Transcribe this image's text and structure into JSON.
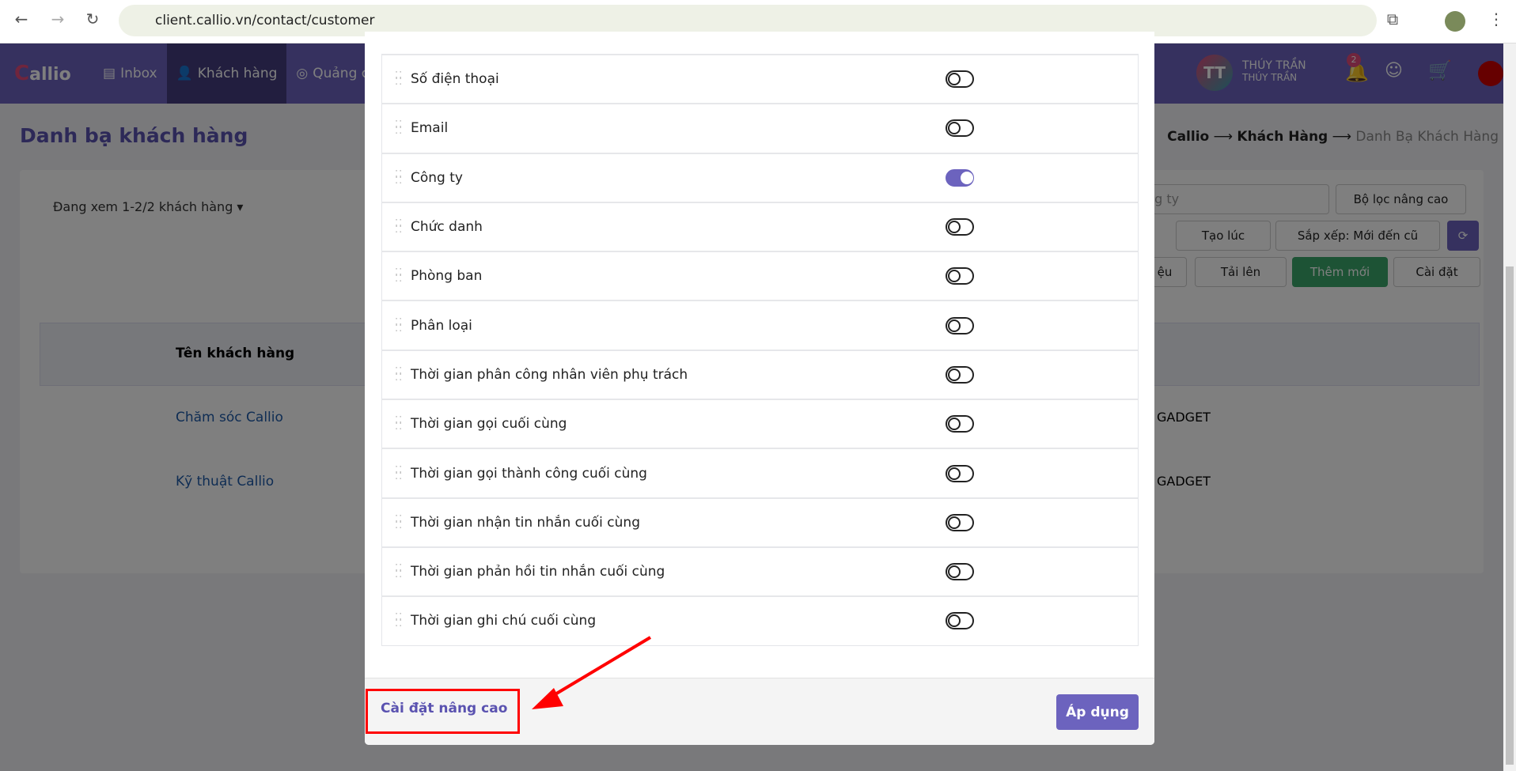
{
  "browser": {
    "url": "client.callio.vn/contact/customer"
  },
  "nav": {
    "logo": "Callio",
    "items": [
      {
        "label": "Inbox"
      },
      {
        "label": "Khách hàng",
        "active": true
      },
      {
        "label": "Quảng cáo"
      }
    ],
    "user": {
      "initials": "TT",
      "name": "THÚY TRẦN",
      "sub": "THÚY TRẦN"
    },
    "notifications": "2"
  },
  "page": {
    "title": "Danh bạ khách hàng",
    "breadcrumb": [
      "Callio",
      "Khách Hàng",
      "Danh Bạ Khách Hàng"
    ],
    "viewing": "Đang xem 1-2/2 khách hàng",
    "search_partial": "ng ty",
    "buttons": {
      "advanced_filter": "Bộ lọc nâng cao",
      "created": "Tạo lúc",
      "sort": "Sắp xếp: Mới đến cũ",
      "data_partial": "ệu",
      "upload": "Tải lên",
      "add_new": "Thêm mới",
      "settings": "Cài đặt"
    },
    "table": {
      "header": "Tên khách hàng",
      "rows": [
        {
          "name": "Chăm sóc Callio",
          "company": "GADGET"
        },
        {
          "name": "Kỹ thuật Callio",
          "company": "GADGET"
        }
      ]
    }
  },
  "modal": {
    "fields": [
      {
        "label": "Số điện thoại",
        "enabled": false
      },
      {
        "label": "Email",
        "enabled": false
      },
      {
        "label": "Công ty",
        "enabled": true
      },
      {
        "label": "Chức danh",
        "enabled": false
      },
      {
        "label": "Phòng ban",
        "enabled": false
      },
      {
        "label": "Phân loại",
        "enabled": false
      },
      {
        "label": "Thời gian phân công nhân viên phụ trách",
        "enabled": false
      },
      {
        "label": "Thời gian gọi cuối cùng",
        "enabled": false
      },
      {
        "label": "Thời gian gọi thành công cuối cùng",
        "enabled": false
      },
      {
        "label": "Thời gian nhận tin nhắn cuối cùng",
        "enabled": false
      },
      {
        "label": "Thời gian phản hồi tin nhắn cuối cùng",
        "enabled": false
      },
      {
        "label": "Thời gian ghi chú cuối cùng",
        "enabled": false
      }
    ],
    "advanced_link": "Cài đặt nâng cao",
    "apply": "Áp dụng"
  },
  "colors": {
    "accent": "#6c63be",
    "annotation": "#ff0000",
    "success": "#3aa66a"
  }
}
